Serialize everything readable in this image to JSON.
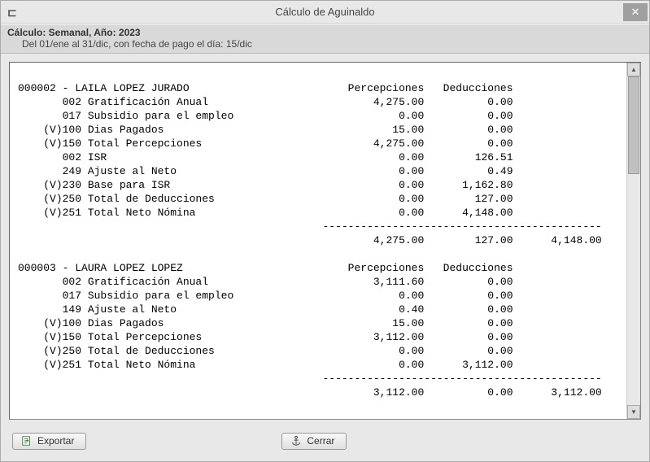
{
  "window": {
    "title": "Cálculo de Aguinaldo",
    "app_icon_glyph": "⊏"
  },
  "header": {
    "line1": "Cálculo: Semanal, Año: 2023",
    "line2": "Del 01/ene al 31/dic, con fecha de pago el día: 15/dic"
  },
  "cols": {
    "percep": "Percepciones",
    "deduc": "Deducciones"
  },
  "employees": [
    {
      "id": "000002",
      "name": "LAILA LOPEZ JURADO",
      "lines": [
        {
          "code": "002",
          "desc": "Gratificación Anual",
          "percep": "4,275.00",
          "deduc": "0.00"
        },
        {
          "code": "017",
          "desc": "Subsidio para el empleo",
          "percep": "0.00",
          "deduc": "0.00"
        },
        {
          "prefix": "(V)",
          "code": "100",
          "desc": "Dias Pagados",
          "percep": "15.00",
          "deduc": "0.00"
        },
        {
          "prefix": "(V)",
          "code": "150",
          "desc": "Total Percepciones",
          "percep": "4,275.00",
          "deduc": "0.00"
        },
        {
          "code": "002",
          "desc": "ISR",
          "percep": "0.00",
          "deduc": "126.51"
        },
        {
          "code": "249",
          "desc": "Ajuste al Neto",
          "percep": "0.00",
          "deduc": "0.49"
        },
        {
          "prefix": "(V)",
          "code": "230",
          "desc": "Base para ISR",
          "percep": "0.00",
          "deduc": "1,162.80"
        },
        {
          "prefix": "(V)",
          "code": "250",
          "desc": "Total de Deducciones",
          "percep": "0.00",
          "deduc": "127.00"
        },
        {
          "prefix": "(V)",
          "code": "251",
          "desc": "Total Neto Nómina",
          "percep": "0.00",
          "deduc": "4,148.00"
        }
      ],
      "totals": {
        "percep": "4,275.00",
        "deduc": "127.00",
        "net": "4,148.00"
      }
    },
    {
      "id": "000003",
      "name": "LAURA LOPEZ LOPEZ",
      "lines": [
        {
          "code": "002",
          "desc": "Gratificación Anual",
          "percep": "3,111.60",
          "deduc": "0.00"
        },
        {
          "code": "017",
          "desc": "Subsidio para el empleo",
          "percep": "0.00",
          "deduc": "0.00"
        },
        {
          "code": "149",
          "desc": "Ajuste al Neto",
          "percep": "0.40",
          "deduc": "0.00"
        },
        {
          "prefix": "(V)",
          "code": "100",
          "desc": "Dias Pagados",
          "percep": "15.00",
          "deduc": "0.00"
        },
        {
          "prefix": "(V)",
          "code": "150",
          "desc": "Total Percepciones",
          "percep": "3,112.00",
          "deduc": "0.00"
        },
        {
          "prefix": "(V)",
          "code": "250",
          "desc": "Total de Deducciones",
          "percep": "0.00",
          "deduc": "0.00"
        },
        {
          "prefix": "(V)",
          "code": "251",
          "desc": "Total Neto Nómina",
          "percep": "0.00",
          "deduc": "3,112.00"
        }
      ],
      "totals": {
        "percep": "3,112.00",
        "deduc": "0.00",
        "net": "3,112.00"
      }
    }
  ],
  "buttons": {
    "export": "Exportar",
    "close": "Cerrar"
  }
}
